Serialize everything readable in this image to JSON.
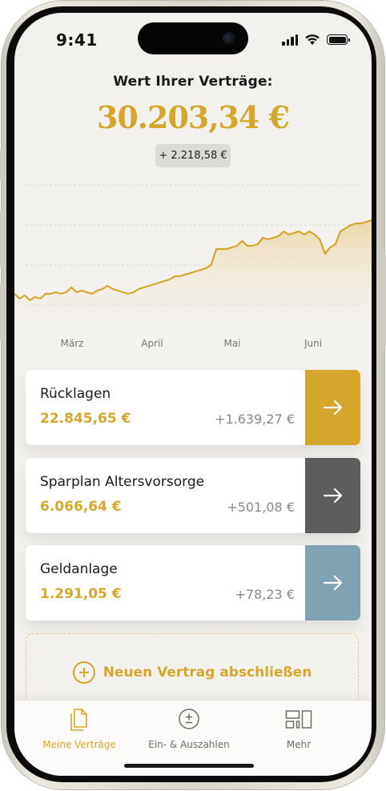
{
  "status_bar": {
    "time": "9:41"
  },
  "header": {
    "title": "Wert Ihrer Verträge:",
    "total": "30.203,34 €",
    "change": "+ 2.218,58 €"
  },
  "chart_data": {
    "type": "area",
    "x_tick_labels": [
      "März",
      "April",
      "Mai",
      "Juni"
    ],
    "y": [
      0.27,
      0.24,
      0.26,
      0.23,
      0.25,
      0.24,
      0.27,
      0.27,
      0.28,
      0.27,
      0.28,
      0.31,
      0.28,
      0.29,
      0.28,
      0.27,
      0.29,
      0.3,
      0.32,
      0.3,
      0.29,
      0.28,
      0.27,
      0.28,
      0.3,
      0.31,
      0.32,
      0.33,
      0.34,
      0.35,
      0.36,
      0.38,
      0.38,
      0.39,
      0.4,
      0.41,
      0.42,
      0.43,
      0.45,
      0.55,
      0.55,
      0.55,
      0.56,
      0.57,
      0.6,
      0.57,
      0.57,
      0.58,
      0.62,
      0.61,
      0.62,
      0.63,
      0.66,
      0.64,
      0.65,
      0.66,
      0.64,
      0.66,
      0.64,
      0.61,
      0.52,
      0.56,
      0.58,
      0.66,
      0.68,
      0.7,
      0.71,
      0.71,
      0.72,
      0.73
    ],
    "color": "#d4a72c",
    "grid": true
  },
  "cards": [
    {
      "name": "Rücklagen",
      "value": "22.845,65 €",
      "delta": "+1.639,27 €",
      "accent": "#d4a72c"
    },
    {
      "name": "Sparplan Altersvorsorge",
      "value": "6.066,64 €",
      "delta": "+501,08 €",
      "accent": "#5d5d5d"
    },
    {
      "name": "Geldanlage",
      "value": "1.291,05 €",
      "delta": "+78,23 €",
      "accent": "#7fa3b3"
    }
  ],
  "new_contract": {
    "label": "Neuen Vertrag abschließen"
  },
  "tabbar": {
    "tabs": [
      {
        "label": "Meine Verträge",
        "icon": "documents-icon",
        "active": true
      },
      {
        "label": "Ein- & Auszahlen",
        "icon": "plus-minus-icon",
        "active": false
      },
      {
        "label": "Mehr",
        "icon": "grid-icon",
        "active": false
      }
    ]
  },
  "colors": {
    "accent": "#d4a72c",
    "background": "#f3f1ee"
  }
}
